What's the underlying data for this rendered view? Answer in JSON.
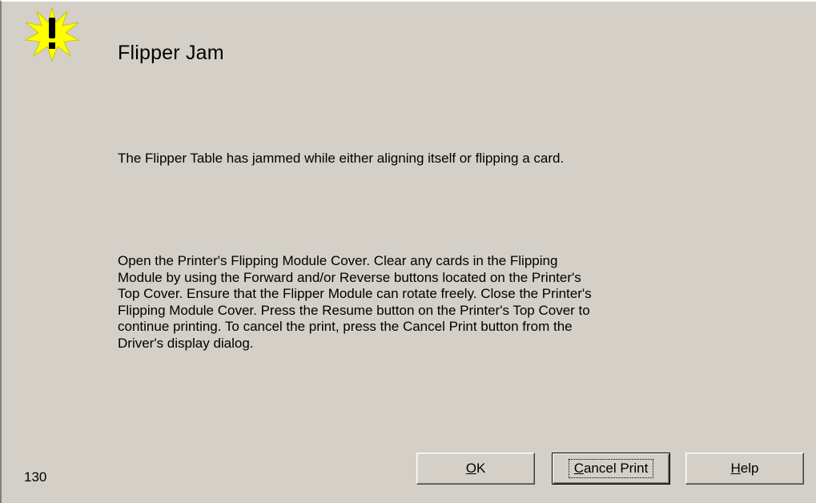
{
  "dialog": {
    "icon": "warning-icon",
    "title": "Flipper Jam",
    "message": "The Flipper Table has jammed while either aligning itself or flipping a card.",
    "instructions_lines": [
      "Open the Printer's Flipping Module Cover. Clear any cards in the Flipping",
      "Module by using the Forward and/or Reverse buttons located on the Printer's",
      "Top Cover. Ensure that the Flipper Module can rotate freely. Close the Printer's",
      "Flipping Module Cover. Press the Resume button on the Printer's Top Cover to",
      "continue printing. To cancel the print, press the Cancel Print button from the",
      "Driver's display dialog."
    ],
    "error_code": "130",
    "buttons": {
      "ok": {
        "mnemonic": "O",
        "rest": "K"
      },
      "cancel_print": {
        "mnemonic": "C",
        "rest": "ancel Print"
      },
      "help": {
        "mnemonic": "H",
        "rest": "elp"
      }
    },
    "colors": {
      "background": "#d4d0c8",
      "icon_starburst": "#ffff00"
    }
  }
}
